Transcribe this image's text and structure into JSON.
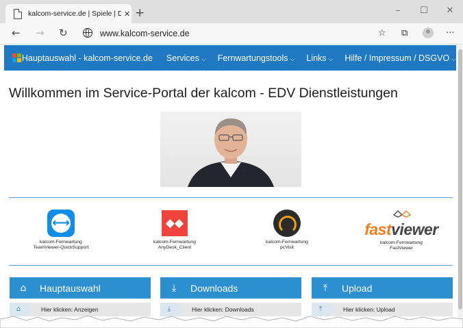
{
  "browser": {
    "tab_title": "kalcom-service.de | Spiele | Das S",
    "tab_close": "✕",
    "new_tab": "+",
    "url": "www.kalcom-service.de",
    "window_minimize": "–",
    "window_maximize": "☐",
    "window_close": "✕",
    "back": "←",
    "forward": "→",
    "refresh": "↻",
    "favorites": "☆",
    "collections": "⧉",
    "more": "···"
  },
  "nav": {
    "brand": "Hauptauswahl - kalcom-service.de",
    "items": [
      {
        "label": "Services",
        "caret": "⌵"
      },
      {
        "label": "Fernwartungstools",
        "caret": "⌵"
      },
      {
        "label": "Links",
        "caret": "⌵"
      },
      {
        "label": "Hilfe / Impressum / DSGVO",
        "caret": "⌵"
      }
    ]
  },
  "page": {
    "heading": "Willkommen im Service-Portal der kalcom - EDV Dienstleistungen"
  },
  "tools": [
    {
      "line1": "kalcom-Fernwartung",
      "line2": "TeamViewer-QuickSupport",
      "icon": "teamviewer-icon"
    },
    {
      "line1": "kalcom-Fernwartung",
      "line2": "AnyDesk_Client",
      "icon": "anydesk-icon",
      "glyph": "◆◆"
    },
    {
      "line1": "kalcom-Fernwartung",
      "line2": "pcVisit",
      "icon": "pcvisit-icon"
    },
    {
      "line1": "kalcom-Fernwartung",
      "line2": "FastViewer",
      "icon": "fastviewer-logo",
      "logo_part1": "fast",
      "logo_part2": "viewer"
    }
  ],
  "panels": [
    {
      "title": "Hauptauswahl",
      "icon": "home-icon",
      "glyph": "⌂",
      "crumb": "Hier klicken: Anzeigen"
    },
    {
      "title": "Downloads",
      "icon": "download-icon",
      "glyph": "⤓",
      "crumb": "Hier klicken: Downloads"
    },
    {
      "title": "Upload",
      "icon": "upload-icon",
      "glyph": "⤒",
      "crumb": "Hier klicken: Upload"
    }
  ],
  "colors": {
    "nav_bg": "#1e78c2",
    "panel_bg": "#2c8fd0",
    "divider": "#5b9bd5"
  }
}
